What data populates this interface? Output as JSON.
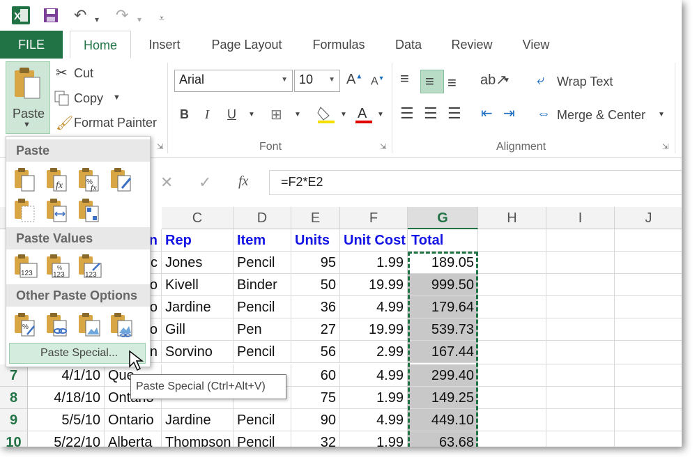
{
  "qat": {
    "save": "Save",
    "undo": "Undo",
    "redo": "Redo"
  },
  "tabs": [
    "FILE",
    "Home",
    "Insert",
    "Page Layout",
    "Formulas",
    "Data",
    "Review",
    "View"
  ],
  "clipboard": {
    "paste": "Paste",
    "cut": "Cut",
    "copy": "Copy",
    "format_painter": "Format Painter"
  },
  "font": {
    "name": "Arial",
    "size": "10",
    "group_label": "Font"
  },
  "alignment": {
    "wrap_text": "Wrap Text",
    "merge_center": "Merge & Center",
    "group_label": "Alignment"
  },
  "formula": {
    "value": "=F2*E2",
    "fx": "fx"
  },
  "columns": [
    "C",
    "D",
    "E",
    "F",
    "G",
    "H",
    "I",
    "J"
  ],
  "headers": {
    "region_partial": "n",
    "rep": "Rep",
    "item": "Item",
    "units": "Units",
    "unit_cost": "Unit Cost",
    "total": "Total"
  },
  "rows": [
    {
      "num": "",
      "b": "c",
      "c": "Jones",
      "d": "Pencil",
      "e": "95",
      "f": "1.99",
      "g": "189.05"
    },
    {
      "num": "",
      "b": "o",
      "c": "Kivell",
      "d": "Binder",
      "e": "50",
      "f": "19.99",
      "g": "999.50"
    },
    {
      "num": "",
      "b": "o",
      "c": "Jardine",
      "d": "Pencil",
      "e": "36",
      "f": "4.99",
      "g": "179.64"
    },
    {
      "num": "",
      "b": "o",
      "c": "Gill",
      "d": "Pen",
      "e": "27",
      "f": "19.99",
      "g": "539.73"
    },
    {
      "num": "",
      "b": "n",
      "c": "Sorvino",
      "d": "Pencil",
      "e": "56",
      "f": "2.99",
      "g": "167.44"
    },
    {
      "num": "7",
      "a": "4/1/10",
      "b": "Que",
      "c": "",
      "d": "",
      "e": "60",
      "f": "4.99",
      "g": "299.40"
    },
    {
      "num": "8",
      "a": "4/18/10",
      "b": "Ontario",
      "c": "",
      "d": "",
      "e": "75",
      "f": "1.99",
      "g": "149.25"
    },
    {
      "num": "9",
      "a": "5/5/10",
      "b": "Ontario",
      "c": "Jardine",
      "d": "Pencil",
      "e": "90",
      "f": "4.99",
      "g": "449.10"
    },
    {
      "num": "10",
      "a": "5/22/10",
      "b": "Alberta",
      "c": "Thompson",
      "d": "Pencil",
      "e": "32",
      "f": "1.99",
      "g": "63.68"
    }
  ],
  "menu": {
    "paste_header": "Paste",
    "paste_values_header": "Paste Values",
    "other_header": "Other Paste Options",
    "paste_special": "Paste Special...",
    "value_icon_label": "123"
  },
  "tooltip": "Paste Special (Ctrl+Alt+V)",
  "colors": {
    "excel_green": "#217346",
    "header_blue": "#1414e6",
    "selection_gray": "#c8c8c8"
  }
}
